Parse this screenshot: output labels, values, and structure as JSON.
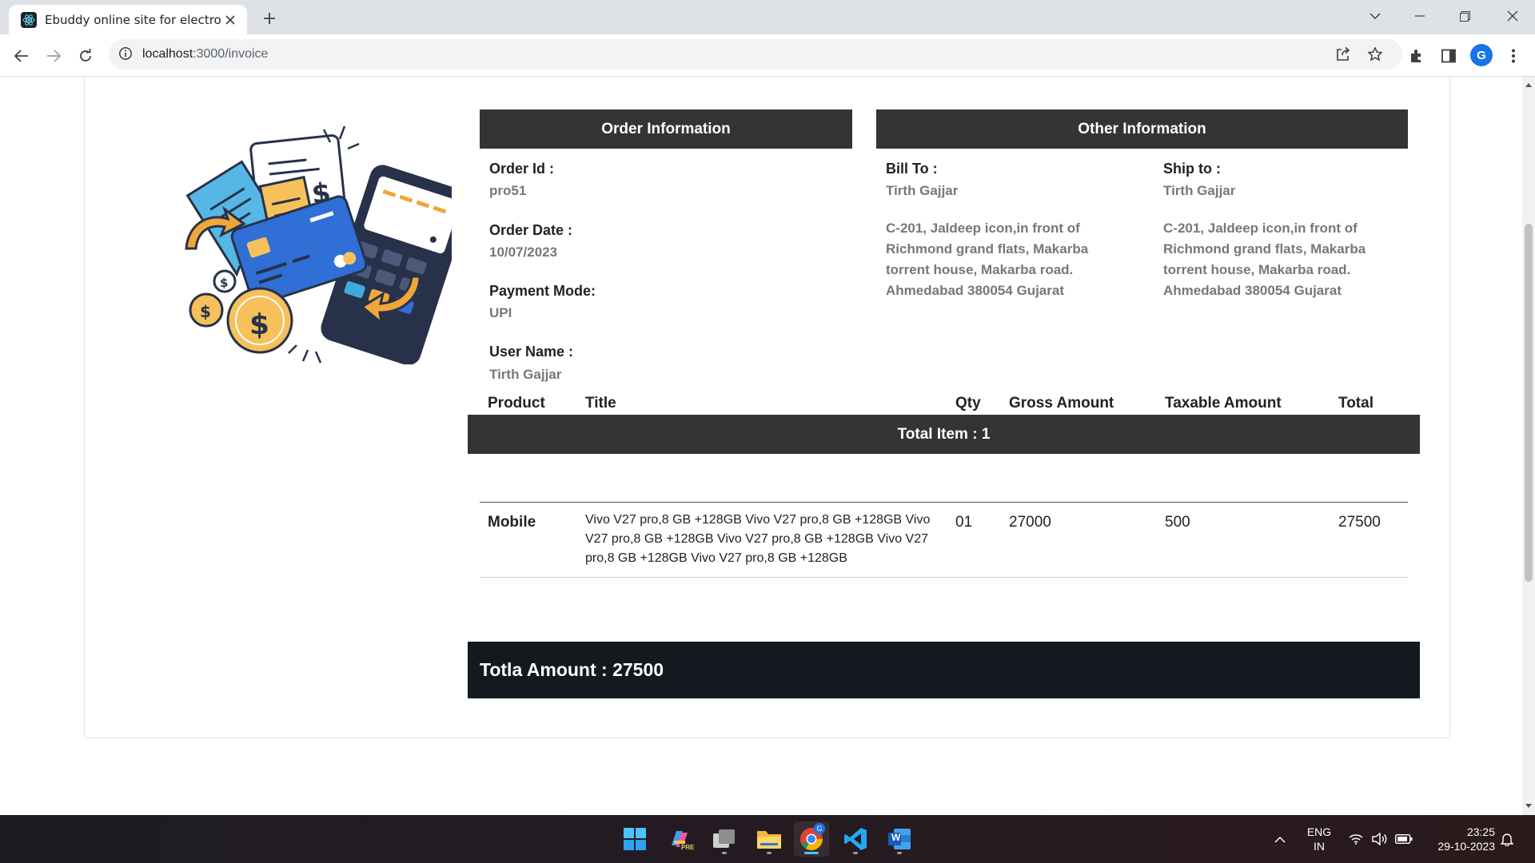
{
  "browser": {
    "tab_title": "Ebuddy online site for electronic",
    "url_host": "localhost",
    "url_path": ":3000/invoice",
    "avatar_letter": "G"
  },
  "order_info": {
    "heading": "Order Information",
    "order_id_label": "Order Id :",
    "order_id": "pro51",
    "order_date_label": "Order Date :",
    "order_date": "10/07/2023",
    "payment_mode_label": "Payment Mode:",
    "payment_mode": "UPI",
    "user_name_label": "User Name :",
    "user_name": "Tirth Gajjar"
  },
  "other_info": {
    "heading": "Other Information",
    "bill_to_label": "Bill To :",
    "bill_to_name": "Tirth Gajjar",
    "bill_to_address": "C-201, Jaldeep icon,in front of Richmond grand flats, Makarba torrent house, Makarba road. Ahmedabad 380054 Gujarat",
    "ship_to_label": "Ship to :",
    "ship_to_name": "Tirth Gajjar",
    "ship_to_address": "C-201, Jaldeep icon,in front of Richmond grand flats, Makarba torrent house, Makarba road. Ahmedabad 380054 Gujarat"
  },
  "items": {
    "heading": "Total Item : 1",
    "columns": [
      "Product",
      "Title",
      "Qty",
      "Gross Amount",
      "Taxable Amount",
      "Total"
    ],
    "rows": [
      {
        "product": "Mobile",
        "title": "Vivo V27 pro,8 GB +128GB Vivo V27 pro,8 GB +128GB Vivo V27 pro,8 GB +128GB Vivo V27 pro,8 GB +128GB Vivo V27 pro,8 GB +128GB Vivo V27 pro,8 GB +128GB",
        "qty": "01",
        "gross_amount": "27000",
        "taxable_amount": "500",
        "total": "27500"
      }
    ]
  },
  "total_amount_text": "Totla Amount : 27500",
  "taskbar": {
    "lang_top": "ENG",
    "lang_bottom": "IN",
    "time": "23:25",
    "date": "29-10-2023",
    "copilot_badge": "PRE",
    "chrome_badge": "G",
    "word_letter": "W"
  },
  "colors": {
    "section_header": "#343434",
    "total_bar": "#141920",
    "muted_text": "#777777",
    "accent_blue": "#1a73e8"
  },
  "icons": [
    "react-favicon",
    "close-icon",
    "plus-icon",
    "chevron-down-icon",
    "minimize-icon",
    "restore-icon",
    "close-window-icon",
    "back-icon",
    "forward-icon",
    "reload-icon",
    "info-icon",
    "share-icon",
    "star-icon",
    "extensions-icon",
    "side-panel-icon",
    "kebab-menu-icon",
    "payment-illustration",
    "windows-start-icon",
    "copilot-icon",
    "task-view-icon",
    "file-explorer-icon",
    "chrome-icon",
    "vscode-icon",
    "word-icon",
    "chevron-up-icon",
    "wifi-icon",
    "volume-icon",
    "battery-icon",
    "bell-icon"
  ]
}
